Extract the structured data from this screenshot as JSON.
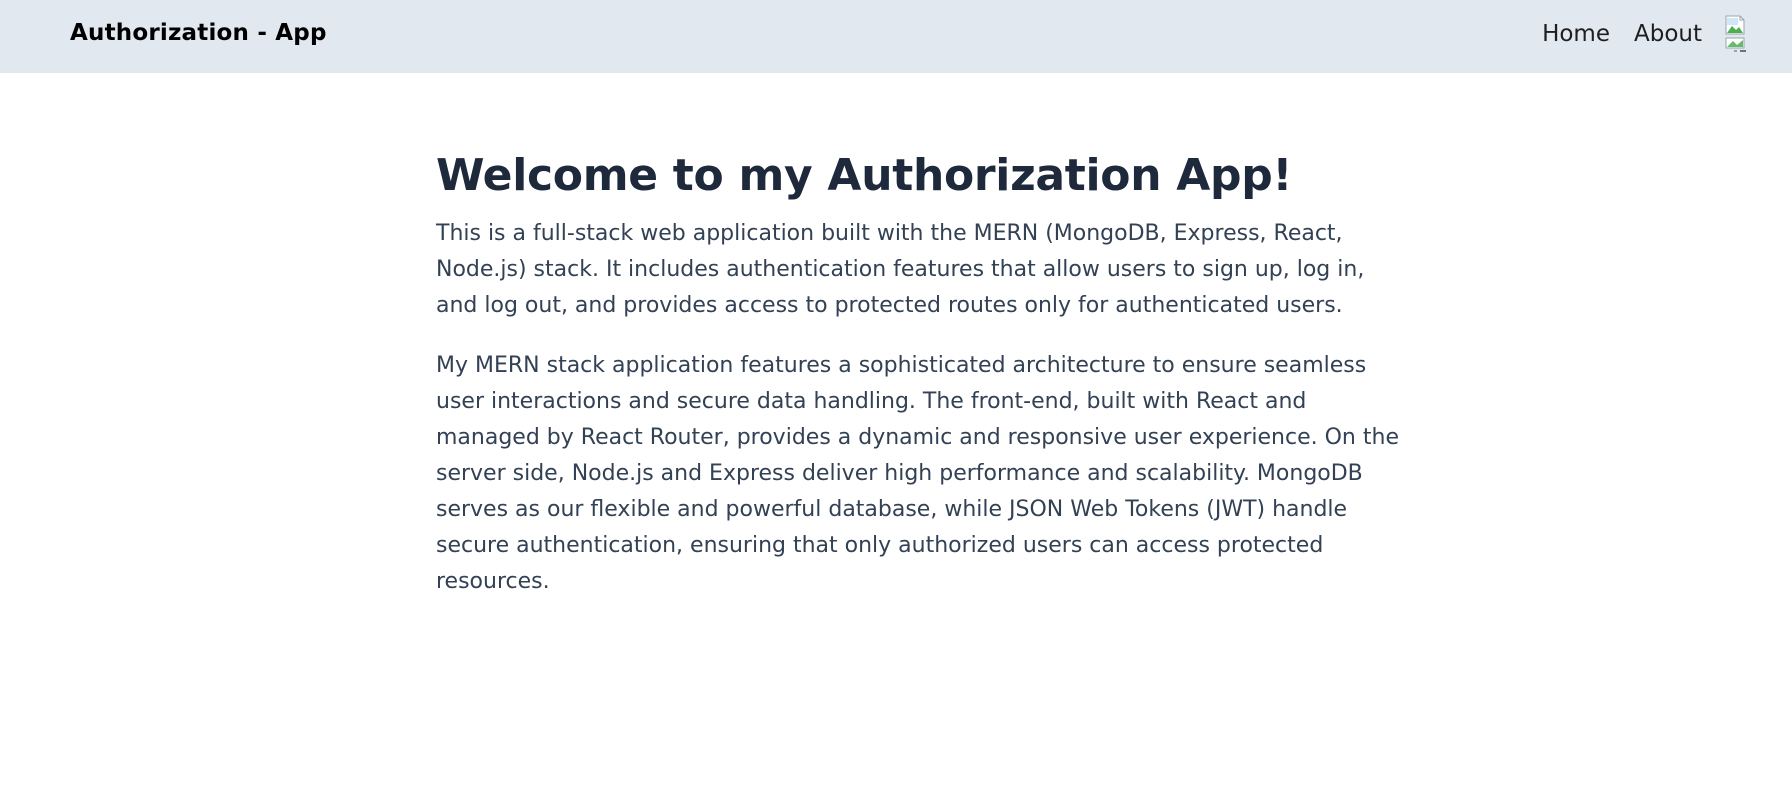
{
  "header": {
    "brand": "Authorization - App",
    "nav": {
      "home_label": "Home",
      "about_label": "About"
    },
    "avatar_icon": "broken-image-icon"
  },
  "main": {
    "title": "Welcome to my Authorization App!",
    "paragraphs": [
      "This is a full-stack web application built with the MERN (MongoDB, Express, React, Node.js) stack. It includes authentication features that allow users to sign up, log in, and log out, and provides access to protected routes only for authenticated users.",
      "My MERN stack application features a sophisticated architecture to ensure seamless user interactions and secure data handling. The front-end, built with React and managed by React Router, provides a dynamic and responsive user experience. On the server side, Node.js and Express deliver high performance and scalability. MongoDB serves as our flexible and powerful database, while JSON Web Tokens (JWT) handle secure authentication, ensuring that only authorized users can access protected resources."
    ]
  },
  "colors": {
    "navbar_bg": "#e2e8f0",
    "title_text": "#1e293b",
    "body_text": "#334155"
  }
}
